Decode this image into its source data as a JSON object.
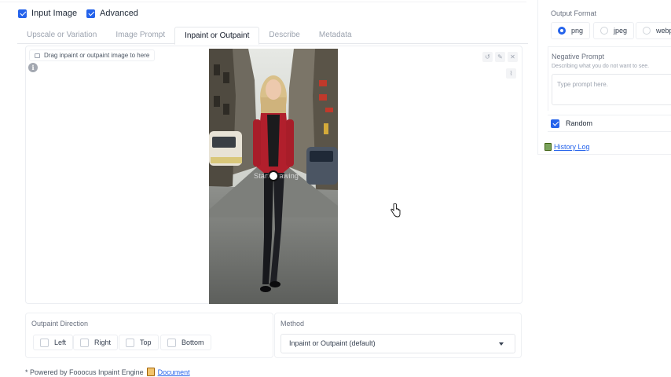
{
  "top": {
    "input_image_label": "Input Image",
    "advanced_label": "Advanced"
  },
  "tabs": [
    {
      "label": "Upscale or Variation",
      "active": false
    },
    {
      "label": "Image Prompt",
      "active": false
    },
    {
      "label": "Inpaint or Outpaint",
      "active": true
    },
    {
      "label": "Describe",
      "active": false
    },
    {
      "label": "Metadata",
      "active": false
    }
  ],
  "canvas": {
    "upload_label": "Drag inpaint or outpaint image to here",
    "overlay_text": "Start Drawing",
    "tool_icons": [
      "undo-icon",
      "erase-icon",
      "close-icon",
      "brush-icon"
    ]
  },
  "outpaint": {
    "title": "Outpaint Direction",
    "options": [
      "Left",
      "Right",
      "Top",
      "Bottom"
    ]
  },
  "method": {
    "title": "Method",
    "selected": "Inpaint or Outpaint (default)"
  },
  "footer": {
    "powered_by": "* Powered by Fooocus Inpaint Engine",
    "document_link": "Document"
  },
  "right": {
    "output_format_title": "Output Format",
    "formats": [
      {
        "label": "png",
        "selected": true
      },
      {
        "label": "jpeg",
        "selected": false
      },
      {
        "label": "webp",
        "selected": false
      }
    ],
    "negative_prompt_title": "Negative Prompt",
    "negative_prompt_info": "Describing what you do not want to see.",
    "negative_prompt_placeholder": "Type prompt here.",
    "random_label": "Random",
    "history_log": "History Log"
  },
  "colors": {
    "accent": "#2563eb",
    "border": "#eceef2"
  }
}
